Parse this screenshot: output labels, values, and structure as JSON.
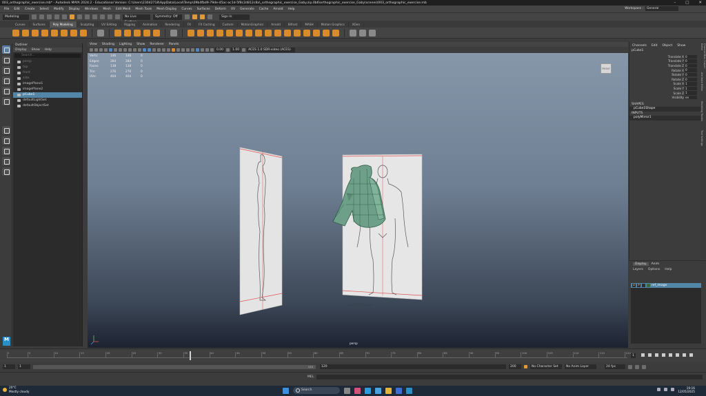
{
  "window": {
    "title": "003_orthographic_exercise.mb* - Autodesk MAYA 2024.2 - Educational Version: C:\\Users\\23042718\\AppData\\Local\\Temp\\09b4fbd9-79de-45ac-ac1d-5f8c2d812c8a\\_orthographic_exercise_Gaby.zip.0b6\\orthographic_exercise_Gaby\\scenes\\003_orthographic_exercise.mb",
    "controls": [
      "–",
      "□",
      "✕"
    ]
  },
  "menubar": {
    "items": [
      "File",
      "Edit",
      "Create",
      "Select",
      "Modify",
      "Display",
      "Windows",
      "Mesh",
      "Edit Mesh",
      "Mesh Tools",
      "Mesh Display",
      "Curves",
      "Surfaces",
      "Deform",
      "UV",
      "Generate",
      "Cache",
      "Arnold",
      "Help"
    ],
    "workspace_label": "Workspace :",
    "workspace_value": "General"
  },
  "statusline": {
    "mode": "Modeling",
    "live_surface": "No Live Surface",
    "symmetry": "Symmetry: Off",
    "signin": "Sign In"
  },
  "shelf": {
    "tabs": [
      "Curves",
      "Surfaces",
      "Poly Modeling",
      "Sculpting",
      "UV Editing",
      "Rigging",
      "Animation",
      "Rendering",
      "FX",
      "FX Caching",
      "Custom",
      "MotionGraphics",
      "Arnold",
      "Bifrost",
      "MASH",
      "Motion Graphics",
      "XGen"
    ],
    "active_tab": "Poly Modeling"
  },
  "outliner": {
    "title": "Outliner",
    "menu": [
      "Display",
      "Show",
      "Help"
    ],
    "search_placeholder": "Search...",
    "items": [
      {
        "label": "persp",
        "state": "dim"
      },
      {
        "label": "top",
        "state": "dim"
      },
      {
        "label": "front",
        "state": "dim"
      },
      {
        "label": "side",
        "state": "dim"
      },
      {
        "label": "imagePlane1",
        "state": "normal"
      },
      {
        "label": "imagePlane2",
        "state": "normal"
      },
      {
        "label": "pCube1",
        "state": "selected"
      },
      {
        "label": "defaultLightSet",
        "state": "normal"
      },
      {
        "label": "defaultObjectSet",
        "state": "normal"
      }
    ]
  },
  "viewport": {
    "menu": [
      "View",
      "Shading",
      "Lighting",
      "Show",
      "Renderer",
      "Panels"
    ],
    "toolbar_values": {
      "value1": "0.00",
      "value2": "1.00",
      "colorspace": "ACES 1.0 SDR-video (ACES)"
    },
    "hud": [
      {
        "label": "Verts:",
        "a": "146",
        "b": "146",
        "c": "0"
      },
      {
        "label": "Edges:",
        "a": "284",
        "b": "284",
        "c": "0"
      },
      {
        "label": "Faces:",
        "a": "138",
        "b": "138",
        "c": "0"
      },
      {
        "label": "Tris:",
        "a": "276",
        "b": "276",
        "c": "0"
      },
      {
        "label": "UVs:",
        "a": "404",
        "b": "404",
        "c": "0"
      }
    ],
    "viewcube_label": "FRONT",
    "camera": "persp"
  },
  "channelbox": {
    "menu": [
      "Channels",
      "Edit",
      "Object",
      "Show"
    ],
    "object": "pCube1",
    "attributes": [
      {
        "name": "Translate X",
        "value": "0"
      },
      {
        "name": "Translate Y",
        "value": "0"
      },
      {
        "name": "Translate Z",
        "value": "0"
      },
      {
        "name": "Rotate X",
        "value": "0"
      },
      {
        "name": "Rotate Y",
        "value": "0"
      },
      {
        "name": "Rotate Z",
        "value": "0"
      },
      {
        "name": "Scale X",
        "value": "1"
      },
      {
        "name": "Scale Y",
        "value": "1"
      },
      {
        "name": "Scale Z",
        "value": "1"
      },
      {
        "name": "Visibility",
        "value": "on"
      }
    ],
    "shapes_label": "SHAPES",
    "shape": "pCube1Shape",
    "inputs_label": "INPUTS",
    "input": "polyMirror1"
  },
  "sidetabs": [
    "Channel Box / Layer Editor",
    "Attribute Editor",
    "Modeling Toolkit",
    "Tool Settings"
  ],
  "layers": {
    "tabs": [
      "Display",
      "Anim"
    ],
    "active_tab": "Display",
    "menu": [
      "Layers",
      "Options",
      "Help"
    ],
    "layer": {
      "v": "V",
      "p": "P",
      "name": "ref_image"
    }
  },
  "timeline": {
    "ticks": [
      "1",
      "5",
      "10",
      "15",
      "20",
      "25",
      "30",
      "35",
      "40",
      "45",
      "50",
      "55",
      "60",
      "65",
      "70",
      "75",
      "80",
      "85",
      "90",
      "95",
      "100",
      "105",
      "110",
      "115",
      "120"
    ],
    "current_frame": "1"
  },
  "rangeslider": {
    "start": "1",
    "start_inner": "1",
    "end_inner": "120",
    "end_mid": "120",
    "end": "200",
    "character_set": "No Character Set",
    "anim_layer": "No Anim Layer",
    "fps": "24 fps"
  },
  "cmdline": {
    "label": "MEL"
  },
  "taskbar": {
    "temperature": "20°C",
    "weather": "Mostly cloudy",
    "search": "Search",
    "time": "19:16",
    "date": "12/05/2025"
  }
}
